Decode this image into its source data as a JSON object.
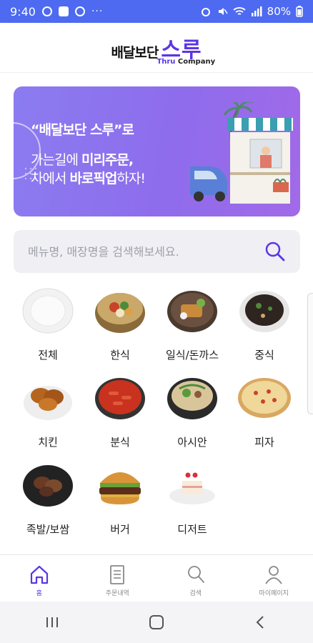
{
  "status": {
    "time": "9:40",
    "battery": "80%",
    "more": "···"
  },
  "header": {
    "logo_ko": "배달보단",
    "logo_big": "스루",
    "logo_sub_a": "Thru",
    "logo_sub_b": " Company"
  },
  "banner": {
    "line1": "“배달보단 스루”로",
    "line2_a": "가는길에 ",
    "line2_b": "미리주문,",
    "line3_a": "차에서 ",
    "line3_b": "바로픽업",
    "line3_c": "하자!"
  },
  "search": {
    "placeholder": "메뉴명, 매장명을 검색해보세요."
  },
  "categories": [
    {
      "label": "전체",
      "icon": "empty-plate-icon"
    },
    {
      "label": "한식",
      "icon": "bibimbap-icon"
    },
    {
      "label": "일식/돈까스",
      "icon": "tonkatsu-icon"
    },
    {
      "label": "중식",
      "icon": "jajangmyeon-icon"
    },
    {
      "label": "치킨",
      "icon": "chicken-icon"
    },
    {
      "label": "분식",
      "icon": "tteokbokki-icon"
    },
    {
      "label": "아시안",
      "icon": "pho-icon"
    },
    {
      "label": "피자",
      "icon": "pizza-icon"
    },
    {
      "label": "족발/보쌈",
      "icon": "jokbal-icon"
    },
    {
      "label": "버거",
      "icon": "burger-icon"
    },
    {
      "label": "디저트",
      "icon": "cake-icon"
    }
  ],
  "nav": [
    {
      "label": "홈",
      "icon": "home-icon",
      "active": true
    },
    {
      "label": "주문내역",
      "icon": "receipt-icon",
      "active": false
    },
    {
      "label": "검색",
      "icon": "search-icon",
      "active": false
    },
    {
      "label": "마이페이지",
      "icon": "person-icon",
      "active": false
    }
  ],
  "colors": {
    "brand": "#5b35e6",
    "status_bar": "#4d6af0",
    "banner_start": "#8b7cf0",
    "banner_end": "#a16ae8"
  }
}
